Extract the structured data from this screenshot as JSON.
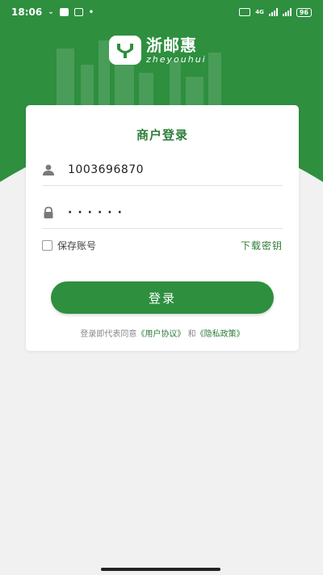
{
  "status_bar": {
    "time": "18:06",
    "network": "4G",
    "battery": "96"
  },
  "brand": {
    "name_cn": "浙邮惠",
    "name_en": "zheyouhui"
  },
  "login": {
    "title": "商户登录",
    "username_value": "1003696870",
    "password_mask": "······",
    "remember_label": "保存账号",
    "download_key_label": "下载密钥",
    "submit_label": "登录",
    "agreement_prefix": "登录即代表同意",
    "agreement_user": "《用户协议》",
    "agreement_and": " 和",
    "agreement_privacy": "《隐私政策》"
  },
  "colors": {
    "brand_green": "#2e8f3f",
    "text_green": "#2e7d3a",
    "background": "#f1f1f2"
  }
}
